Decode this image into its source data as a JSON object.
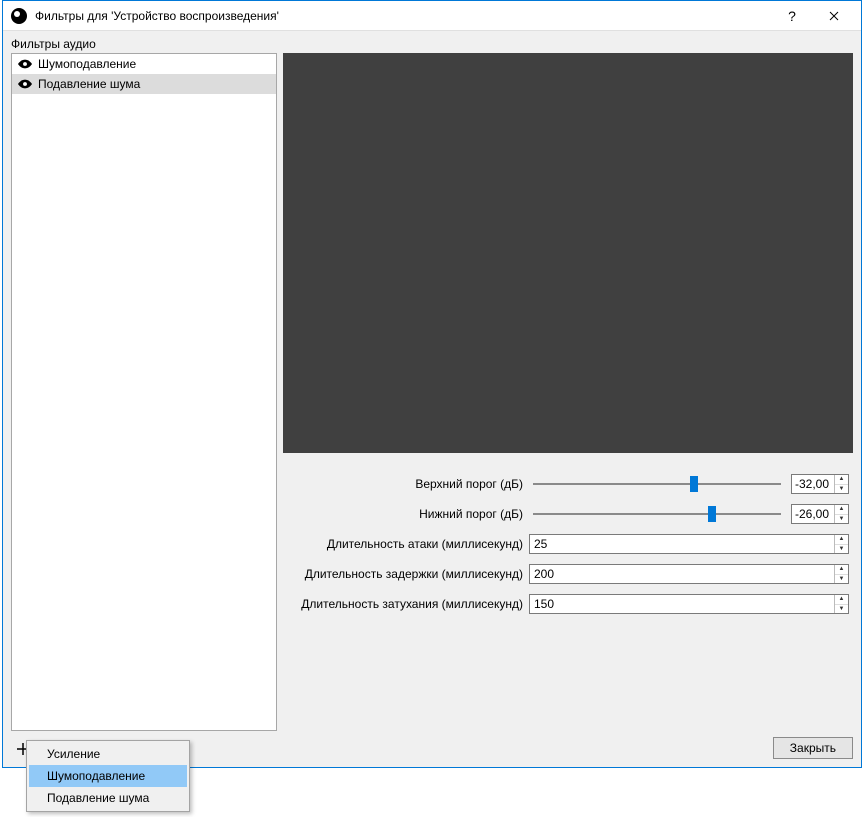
{
  "titlebar": {
    "title": "Фильтры для 'Устройство воспроизведения'",
    "help": "?",
    "close": "✕"
  },
  "left": {
    "heading": "Фильтры аудио",
    "items": [
      {
        "name": "Шумоподавление",
        "selected": false
      },
      {
        "name": "Подавление шума",
        "selected": true
      }
    ]
  },
  "params": {
    "upper_threshold": {
      "label": "Верхний порог (дБ)",
      "value": "-32,00",
      "slider_pct": 65
    },
    "lower_threshold": {
      "label": "Нижний порог (дБ)",
      "value": "-26,00",
      "slider_pct": 72
    },
    "attack": {
      "label": "Длительность атаки (миллисекунд)",
      "value": "25"
    },
    "hold": {
      "label": "Длительность задержки (миллисекунд)",
      "value": "200"
    },
    "release": {
      "label": "Длительность затухания (миллисекунд)",
      "value": "150"
    }
  },
  "toolbar": {
    "add": "＋",
    "remove": "－",
    "up": "˄",
    "down": "˅"
  },
  "close_button": "Закрыть",
  "context_menu": {
    "items": [
      {
        "label": "Усиление",
        "highlight": false
      },
      {
        "label": "Шумоподавление",
        "highlight": true
      },
      {
        "label": "Подавление шума",
        "highlight": false
      }
    ]
  }
}
